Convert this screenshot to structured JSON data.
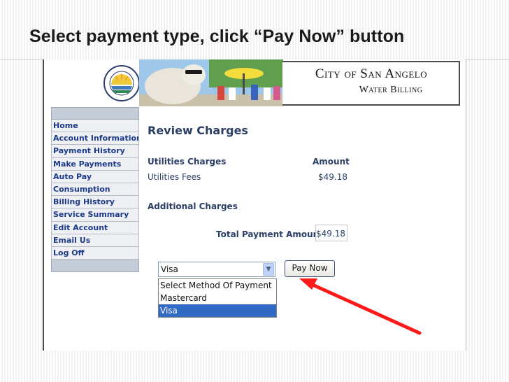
{
  "slide": {
    "title": "Select payment type, click “Pay Now” button"
  },
  "header": {
    "city_name": "City of San Angelo",
    "subtitle": "Water Billing",
    "seal_top_text": "THE CITY OF SAN ANGELO",
    "seal_bottom_text": "TEXAS"
  },
  "nav": {
    "items": [
      {
        "label": "Home"
      },
      {
        "label": "Account Information"
      },
      {
        "label": "Payment  History"
      },
      {
        "label": "Make Payments"
      },
      {
        "label": "Auto Pay"
      },
      {
        "label": "Consumption"
      },
      {
        "label": "Billing History"
      },
      {
        "label": "Service  Summary"
      },
      {
        "label": "Edit Account"
      },
      {
        "label": "Email Us"
      },
      {
        "label": "Log Off"
      }
    ]
  },
  "review": {
    "title": "Review Charges",
    "utilities_header": "Utilities Charges",
    "amount_header": "Amount",
    "utilities_fees_label": "Utilities Fees",
    "utilities_fees_amount": "$49.18",
    "additional_header": "Additional Charges",
    "total_label": "Total Payment Amount:",
    "total_amount": "$49.18"
  },
  "payment": {
    "selected": "Visa",
    "options": [
      {
        "label": "Select Method Of Payment",
        "selected": false
      },
      {
        "label": "Mastercard",
        "selected": false
      },
      {
        "label": "Visa",
        "selected": true
      }
    ],
    "pay_button": "Pay Now"
  },
  "colors": {
    "nav_text": "#1c3a8a",
    "content_text": "#2b3f66",
    "selected_option": "#316ac5",
    "arrow": "#ff1a1a"
  }
}
